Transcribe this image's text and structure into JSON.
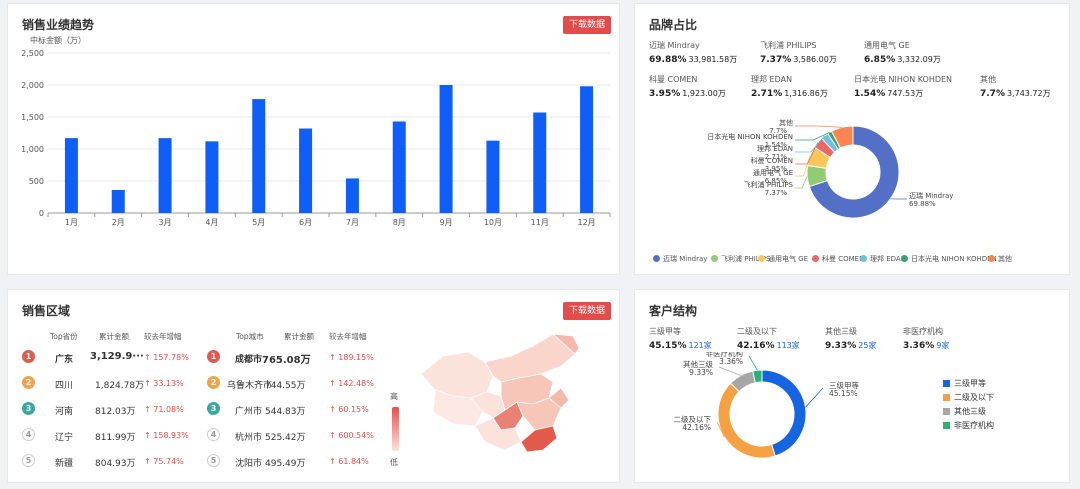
{
  "sales_trend": {
    "title": "销售业绩趋势",
    "download_label": "下载数据"
  },
  "chart_data": {
    "type": "bar",
    "ylabel": "中标金额（万）",
    "ylim": [
      0,
      2500
    ],
    "yticks": [
      "0",
      "500",
      "1,000",
      "1,500",
      "2,000",
      "2,500"
    ],
    "categories": [
      "1月",
      "2月",
      "3月",
      "4月",
      "5月",
      "6月",
      "7月",
      "8月",
      "9月",
      "10月",
      "11月",
      "12月"
    ],
    "values": [
      1170,
      360,
      1170,
      1120,
      1780,
      1320,
      540,
      1430,
      2000,
      1130,
      1570,
      1980
    ],
    "color": "#0f5ef7",
    "grid": true
  },
  "brand": {
    "title": "品牌占比",
    "stats": [
      {
        "name": "迈瑞 Mindray",
        "pct": "69.88%",
        "amount": "33,981.58万"
      },
      {
        "name": "飞利浦 PHILIPS",
        "pct": "7.37%",
        "amount": "3,586.00万"
      },
      {
        "name": "通用电气 GE",
        "pct": "6.85%",
        "amount": "3,332.09万"
      },
      {
        "name": "科曼 COMEN",
        "pct": "3.95%",
        "amount": "1,923.00万"
      },
      {
        "name": "理邦 EDAN",
        "pct": "2.71%",
        "amount": "1,316.86万"
      },
      {
        "name": "日本光电 NIHON KOHDEN",
        "pct": "1.54%",
        "amount": "747.53万"
      },
      {
        "name": "其他",
        "pct": "7.7%",
        "amount": "3,743.72万"
      }
    ],
    "pie": [
      {
        "name": "迈瑞 Mindray",
        "value": 69.88,
        "label": "69.88%",
        "color": "#5470c6"
      },
      {
        "name": "飞利浦 PHILIPS",
        "value": 7.37,
        "label": "7.37%",
        "color": "#91cc75"
      },
      {
        "name": "通用电气 GE",
        "value": 6.85,
        "label": "6.85%",
        "color": "#fac858"
      },
      {
        "name": "科曼 COMEN",
        "value": 3.95,
        "label": "3.95%",
        "color": "#ee6666"
      },
      {
        "name": "理邦 EDAN",
        "value": 2.71,
        "label": "2.71%",
        "color": "#73c0de"
      },
      {
        "name": "日本光电 NIHON KOHDEN",
        "value": 1.54,
        "label": "1.54%",
        "color": "#3ba272"
      },
      {
        "name": "其他",
        "value": 7.7,
        "label": "7.7%",
        "color": "#fc8452"
      }
    ]
  },
  "region": {
    "title": "销售区域",
    "download_label": "下载数据",
    "prov_headers": [
      "Top省份",
      "累计金额",
      "较去年增幅"
    ],
    "city_headers": [
      "Top城市",
      "累计金额",
      "较去年增幅"
    ],
    "provinces": [
      {
        "rank": "1",
        "name": "广东",
        "amount": "3,129.9···",
        "growth": "↑ 157.78%"
      },
      {
        "rank": "2",
        "name": "四川",
        "amount": "1,824.78万",
        "growth": "↑ 33.13%"
      },
      {
        "rank": "3",
        "name": "河南",
        "amount": "812.03万",
        "growth": "↑ 71.08%"
      },
      {
        "rank": "4",
        "name": "辽宁",
        "amount": "811.99万",
        "growth": "↑ 158.93%"
      },
      {
        "rank": "5",
        "name": "新疆",
        "amount": "804.93万",
        "growth": "↑ 75.74%"
      }
    ],
    "cities": [
      {
        "rank": "1",
        "name": "成都市",
        "amount": "765.08万",
        "growth": "↑ 189.15%"
      },
      {
        "rank": "2",
        "name": "乌鲁木齐市",
        "amount": "744.55万",
        "growth": "↑ 142.48%"
      },
      {
        "rank": "3",
        "name": "广州市",
        "amount": "544.83万",
        "growth": "↑ 60.15%"
      },
      {
        "rank": "4",
        "name": "杭州市",
        "amount": "525.42万",
        "growth": "↑ 600.54%"
      },
      {
        "rank": "5",
        "name": "沈阳市",
        "amount": "495.49万",
        "growth": "↑ 61.84%"
      }
    ],
    "map_high": "高",
    "map_low": "低"
  },
  "customer": {
    "title": "客户结构",
    "stats": [
      {
        "name": "三级甲等",
        "pct": "45.15%",
        "count": "121家"
      },
      {
        "name": "二级及以下",
        "pct": "42.16%",
        "count": "113家"
      },
      {
        "name": "其他三级",
        "pct": "9.33%",
        "count": "25家"
      },
      {
        "name": "非医疗机构",
        "pct": "3.36%",
        "count": "9家"
      }
    ],
    "pie": [
      {
        "name": "三级甲等",
        "value": 45.15,
        "label": "45.15%",
        "color": "#1565e0"
      },
      {
        "name": "二级及以下",
        "value": 42.16,
        "label": "42.16%",
        "color": "#f5a043"
      },
      {
        "name": "其他三级",
        "value": 9.33,
        "label": "9.33%",
        "color": "#a6a6a6"
      },
      {
        "name": "非医疗机构",
        "value": 3.36,
        "label": "3.36%",
        "color": "#2bb17a"
      }
    ]
  }
}
